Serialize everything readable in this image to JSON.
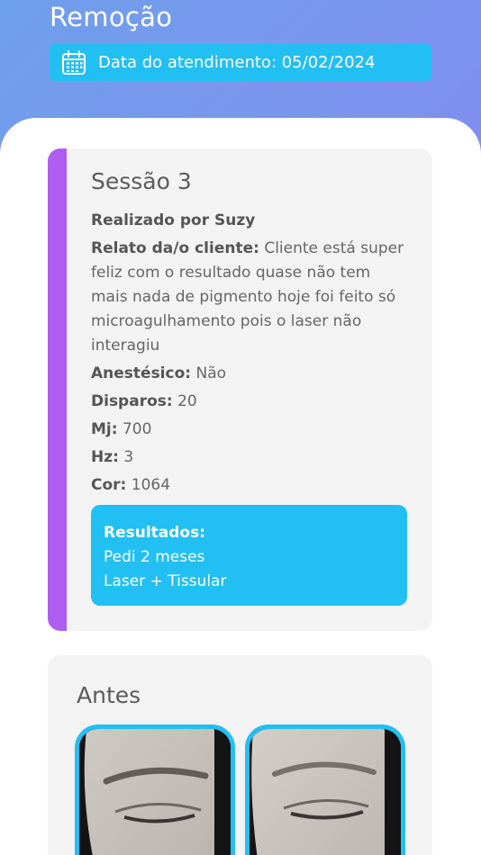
{
  "header": {
    "title": "Remoção",
    "date_label": "Data do atendimento: 05/02/2024"
  },
  "session": {
    "title": "Sessão 3",
    "performed_by": "Realizado por Suzy",
    "report_label": "Relato da/o cliente:",
    "report_text": "Cliente está super feliz com o resultado quase não tem mais nada de pigmento hoje foi feito só microagulhamento pois o laser não interagiu",
    "fields": [
      {
        "label": "Anestésico:",
        "value": "Não"
      },
      {
        "label": "Disparos:",
        "value": "20"
      },
      {
        "label": "Mj:",
        "value": "700"
      },
      {
        "label": "Hz:",
        "value": "3"
      },
      {
        "label": "Cor:",
        "value": "1064"
      }
    ],
    "results": {
      "title": "Resultados:",
      "lines": [
        "Pedi 2 meses",
        "Laser + Tissular"
      ]
    }
  },
  "before": {
    "title": "Antes",
    "photos": [
      "eyebrow-photo",
      "eyebrow-photo"
    ]
  },
  "colors": {
    "accent_cyan": "#22bff2",
    "accent_purple": "#ae5ef0"
  }
}
